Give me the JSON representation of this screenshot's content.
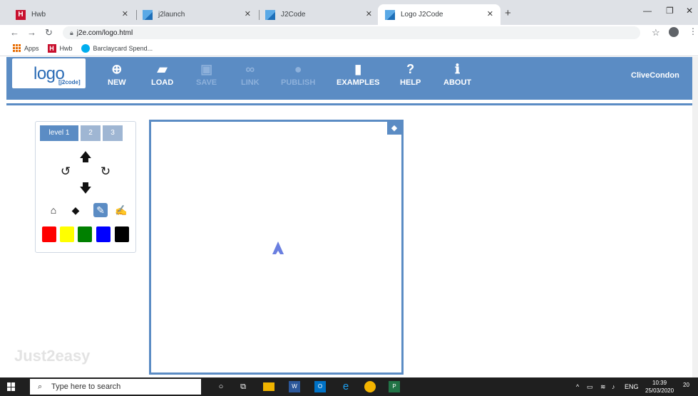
{
  "browser": {
    "tabs": [
      {
        "title": "Hwb",
        "favicon": "hwb-icon"
      },
      {
        "title": "j2launch",
        "favicon": "j2e-icon"
      },
      {
        "title": "J2Code",
        "favicon": "j2e-icon"
      },
      {
        "title": "Logo J2Code",
        "favicon": "j2e-icon",
        "active": true
      }
    ],
    "url": "j2e.com/logo.html",
    "bookmarks": [
      "Apps",
      "Hwb",
      "Barclaycard Spend..."
    ]
  },
  "app": {
    "logo_main": "logo",
    "logo_sub": "[j2code]",
    "nav": [
      {
        "label": "NEW",
        "icon": "plus-circle-icon",
        "enabled": true
      },
      {
        "label": "LOAD",
        "icon": "folder-open-icon",
        "enabled": true
      },
      {
        "label": "SAVE",
        "icon": "floppy-disk-icon",
        "enabled": false
      },
      {
        "label": "LINK",
        "icon": "link-icon",
        "enabled": false
      },
      {
        "label": "PUBLISH",
        "icon": "globe-icon",
        "enabled": false
      },
      {
        "label": "EXAMPLES",
        "icon": "bookmark-icon",
        "enabled": true
      },
      {
        "label": "HELP",
        "icon": "question-mark-icon",
        "enabled": true
      },
      {
        "label": "ABOUT",
        "icon": "info-icon",
        "enabled": true
      }
    ],
    "user": "CliveCondon"
  },
  "palette": {
    "levels": [
      "level 1",
      "2",
      "3"
    ],
    "active_level": "level 1",
    "colors": [
      "#ff0000",
      "#ffff00",
      "#008000",
      "#0000ff",
      "#000000"
    ]
  },
  "brand": "Just2easy",
  "taskbar": {
    "search_placeholder": "Type here to search",
    "language": "ENG",
    "time": "10:39",
    "date": "25/03/2020",
    "notification_count": "20"
  },
  "theme": {
    "accent": "#5b8cc4",
    "turtle": "#6a7fe0"
  }
}
